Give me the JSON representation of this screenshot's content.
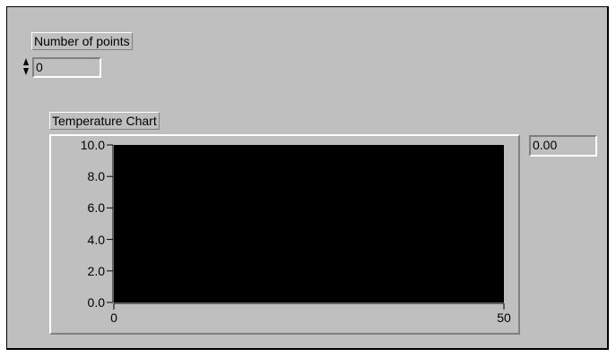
{
  "controls": {
    "num_points_label": "Number of points",
    "num_points_value": "0",
    "chart_label": "Temperature Chart",
    "digital_display_value": "0.00"
  },
  "colors": {
    "panel_background": "#bfbfbf",
    "plot_background": "#000000"
  },
  "chart_data": {
    "type": "line",
    "title": "Temperature Chart",
    "xlabel": "",
    "ylabel": "",
    "xlim": [
      0,
      50
    ],
    "ylim": [
      0.0,
      10.0
    ],
    "x_ticks": [
      "0",
      "50"
    ],
    "y_ticks": [
      "10.0",
      "8.0",
      "6.0",
      "4.0",
      "2.0",
      "0.0"
    ],
    "series": [],
    "grid": false
  }
}
